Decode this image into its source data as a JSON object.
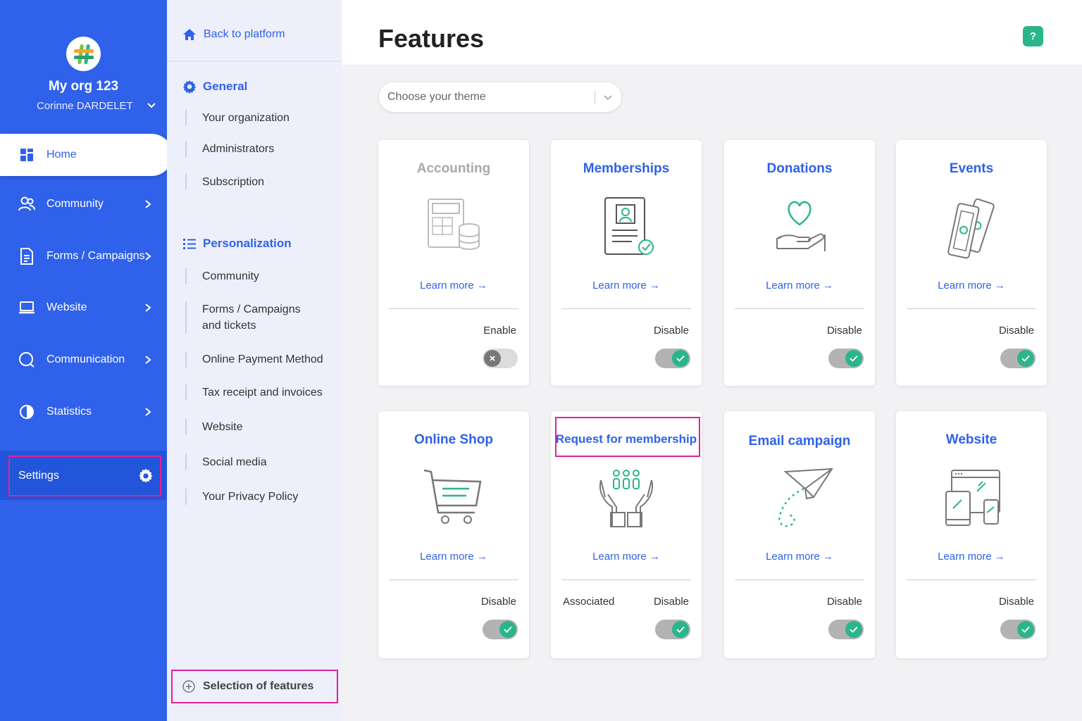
{
  "sidebar": {
    "org_name": "My org 123",
    "user_name": "Corinne DARDELET",
    "nav": [
      {
        "label": "Home",
        "icon": "dashboard-icon"
      },
      {
        "label": "Community",
        "icon": "users-icon"
      },
      {
        "label": "Forms / Campaigns",
        "icon": "document-icon"
      },
      {
        "label": "Website",
        "icon": "laptop-icon"
      },
      {
        "label": "Communication",
        "icon": "chat-icon"
      },
      {
        "label": "Statistics",
        "icon": "pie-chart-icon"
      }
    ],
    "settings_label": "Settings"
  },
  "submenu": {
    "back_label": "Back to platform",
    "general_title": "General",
    "general_items": [
      "Your organization",
      "Administrators",
      "Subscription"
    ],
    "personalization_title": "Personalization",
    "personalization_items": [
      "Community",
      "Forms / Campaigns and tickets",
      "Online Payment Method",
      "Tax receipt and invoices",
      "Website",
      "Social media",
      "Your Privacy Policy"
    ],
    "features_selection_label": "Selection of features"
  },
  "main": {
    "title": "Features",
    "help_label": "?",
    "theme_placeholder": "Choose your theme"
  },
  "cards": [
    {
      "title": "Accounting",
      "learn_more": "Learn more →",
      "status": "Enable",
      "enabled": false,
      "icon": "calculator-icon"
    },
    {
      "title": "Memberships",
      "learn_more": "Learn more →",
      "status": "Disable",
      "enabled": true,
      "icon": "membership-card-icon"
    },
    {
      "title": "Donations",
      "learn_more": "Learn more →",
      "status": "Disable",
      "enabled": true,
      "icon": "heart-hand-icon"
    },
    {
      "title": "Events",
      "learn_more": "Learn more →",
      "status": "Disable",
      "enabled": true,
      "icon": "tickets-icon"
    },
    {
      "title": "Online Shop",
      "learn_more": "Learn more →",
      "status": "Disable",
      "enabled": true,
      "icon": "cart-icon"
    },
    {
      "title": "Request for membership",
      "learn_more": "Learn more →",
      "status": "Disable",
      "associated": "Associated",
      "enabled": true,
      "icon": "people-hands-icon"
    },
    {
      "title": "Email campaign",
      "learn_more": "Learn more →",
      "status": "Disable",
      "enabled": true,
      "icon": "paper-plane-icon"
    },
    {
      "title": "Website",
      "learn_more": "Learn more →",
      "status": "Disable",
      "enabled": true,
      "icon": "devices-icon"
    }
  ],
  "colors": {
    "primary": "#2f61ea",
    "accent": "#2bb58b",
    "highlight": "#e0219b"
  }
}
